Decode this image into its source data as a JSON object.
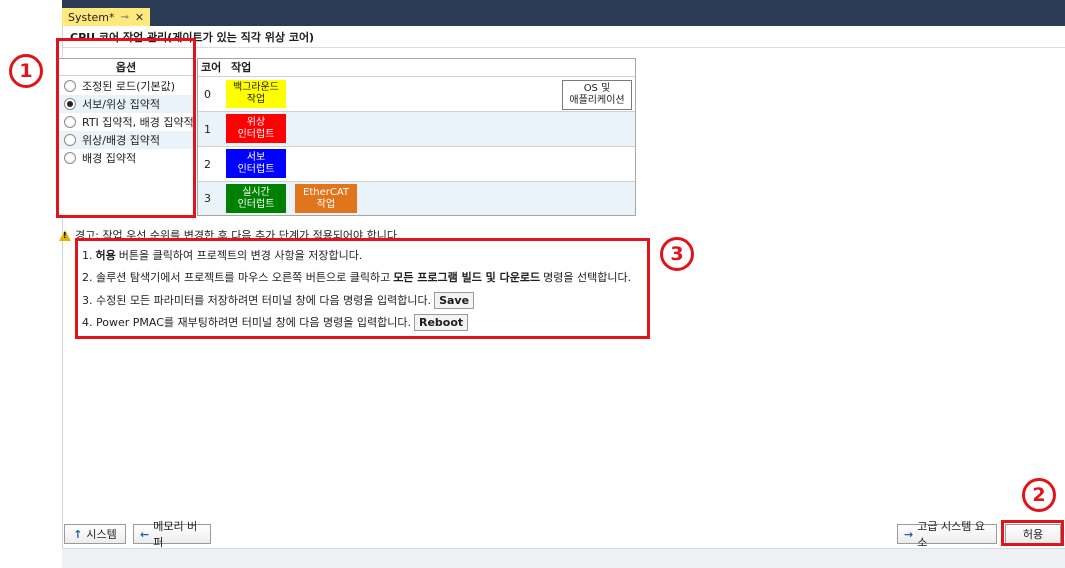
{
  "tab": {
    "title": "System*",
    "pin": "⊸",
    "close": "✕"
  },
  "header": {
    "title": "CPU 코어 작업 관리(게이트가 있는 직각 위상 코어)"
  },
  "options": {
    "header": "옵션",
    "items": [
      {
        "label": "조정된 로드(기본값)",
        "selected": false
      },
      {
        "label": "서보/위상 집약적",
        "selected": true
      },
      {
        "label": "RTI 집약적, 배경 집약적",
        "selected": false
      },
      {
        "label": "위상/배경 집약적",
        "selected": false
      },
      {
        "label": "배경 집약적",
        "selected": false
      }
    ]
  },
  "task_table": {
    "col_core": "코어",
    "col_task": "작업",
    "rows": [
      {
        "core": "0",
        "tasks": [
          {
            "line1": "백그라운드",
            "line2": "작업",
            "bg": "#ffff00",
            "fg": "#1e1e1e"
          }
        ]
      },
      {
        "core": "1",
        "tasks": [
          {
            "line1": "위상",
            "line2": "인터럽트",
            "bg": "#ff0000",
            "fg": "#ffffff"
          }
        ]
      },
      {
        "core": "2",
        "tasks": [
          {
            "line1": "서보",
            "line2": "인터럽트",
            "bg": "#0000ff",
            "fg": "#ffffff"
          }
        ]
      },
      {
        "core": "3",
        "tasks": [
          {
            "line1": "실시간",
            "line2": "인터럽트",
            "bg": "#008000",
            "fg": "#ffffff"
          },
          {
            "line1": "EtherCAT",
            "line2": "작업",
            "bg": "#e0751b",
            "fg": "#ffffff"
          }
        ]
      }
    ],
    "os_box": {
      "line1": "OS 및",
      "line2": "애플리케이션"
    }
  },
  "warning": {
    "text": "경고: 작업 우선 순위를 변경한 후 다음 추가 단계가 적용되어야 합니다."
  },
  "steps": {
    "s1_pre": "1.",
    "s1_bold": "허용",
    "s1_post": "버튼을 클릭하여 프로젝트의 변경 사항을 저장합니다.",
    "s2_pre": "2. 솔루션 탐색기에서 프로젝트를 마우스 오른쪽 버튼으로 클릭하고",
    "s2_bold": "모든 프로그램 빌드 및 다운로드",
    "s2_post": "명령을 선택합니다.",
    "s3_text": "3. 수정된 모든 파라미터를 저장하려면 터미널 창에 다음 명령을 입력합니다.",
    "s3_cmd": "Save",
    "s4_text": "4. Power PMAC를 재부팅하려면 터미널 창에 다음 명령을 입력합니다.",
    "s4_cmd": "Reboot"
  },
  "buttons": {
    "system": "시스템",
    "memory_buffer": "메모리 버퍼",
    "advanced": "고급 시스템 요소",
    "allow": "허용"
  },
  "callouts": {
    "c1": "1",
    "c2": "2",
    "c3": "3"
  },
  "colors": {
    "highlight": "#e0151b",
    "tab_strip": "#2b3a55",
    "tab_active": "#ffe97d"
  }
}
